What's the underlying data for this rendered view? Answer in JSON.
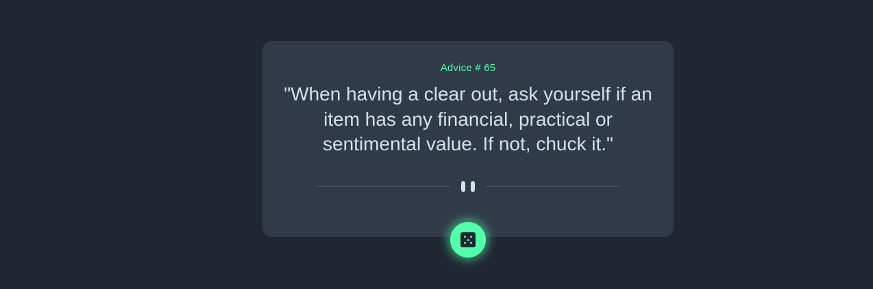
{
  "advice": {
    "label": "Advice #",
    "number": "65",
    "text": "\"When having a clear out, ask yourself if an item has any financial, practical or sentimental value. If not, chuck it.\""
  },
  "icons": {
    "divider": "pause-icon",
    "button": "dice-icon"
  },
  "colors": {
    "background": "#202632",
    "card": "#313a49",
    "accent": "#53ffaa",
    "text": "#cee3e9",
    "divider": "#4f5d74"
  }
}
